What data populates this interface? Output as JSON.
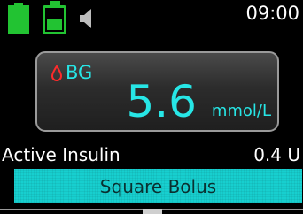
{
  "status": {
    "time": "09:00",
    "battery_icon": "battery-full-icon",
    "reservoir_icon": "reservoir-icon",
    "sound_icon": "speaker-icon",
    "battery_color": "#22c332"
  },
  "bg": {
    "label": "BG",
    "value": "5.6",
    "unit": "mmol/L",
    "color": "#27e6e6",
    "drop_color": "#ff2b2b"
  },
  "active_insulin": {
    "label": "Active Insulin",
    "value": "0.4 U"
  },
  "bolus": {
    "label": "Square Bolus",
    "color": "#17cfcf"
  }
}
